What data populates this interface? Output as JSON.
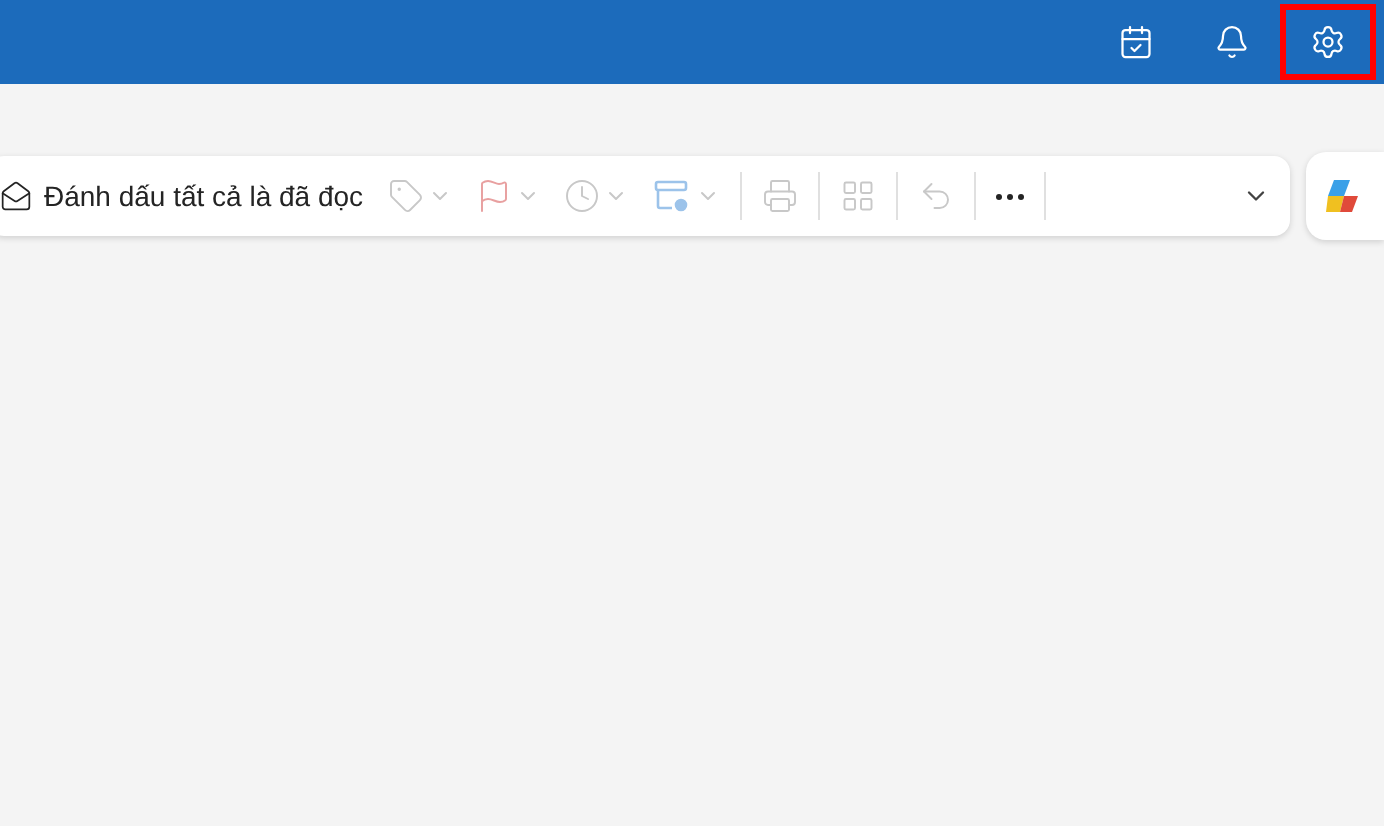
{
  "header": {
    "buttons": [
      {
        "kind": "calendar-check",
        "highlighted": false
      },
      {
        "kind": "bell",
        "highlighted": false
      },
      {
        "kind": "settings",
        "highlighted": true
      }
    ]
  },
  "toolbar": {
    "mark_all_read": {
      "label": "Đánh dấu tất cả là đã đọc",
      "disabled": false
    },
    "tools": [
      {
        "kind": "tag",
        "disabled": true,
        "dropdown": true
      },
      {
        "kind": "flag",
        "disabled": true,
        "dropdown": true
      },
      {
        "kind": "clock",
        "disabled": true,
        "dropdown": true
      },
      {
        "kind": "rules",
        "disabled": true,
        "dropdown": true
      },
      {
        "kind": "print",
        "disabled": true,
        "dropdown": false
      },
      {
        "kind": "grid",
        "disabled": true,
        "dropdown": false
      },
      {
        "kind": "undo",
        "disabled": true,
        "dropdown": false
      },
      {
        "kind": "more",
        "disabled": false,
        "dropdown": false
      }
    ]
  }
}
